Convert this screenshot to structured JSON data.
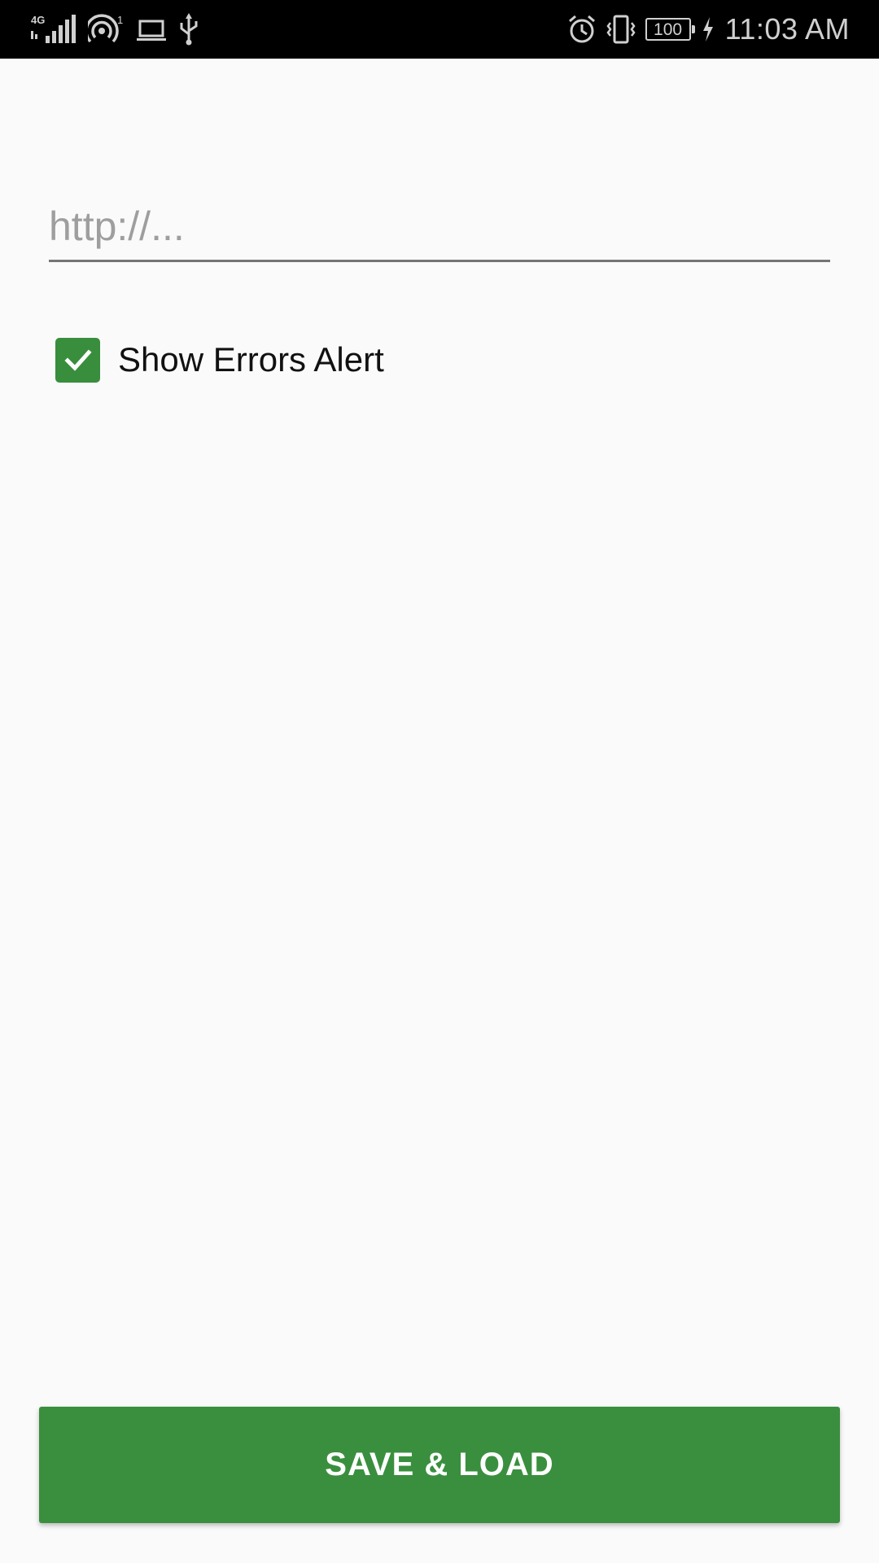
{
  "status_bar": {
    "network_label": "4G",
    "hotspot_count": "1",
    "battery_level": "100",
    "time": "11:03 AM",
    "left_icons": [
      "signal-4g-icon",
      "hotspot-icon",
      "laptop-icon",
      "usb-icon"
    ],
    "right_icons": [
      "alarm-icon",
      "vibrate-icon",
      "battery-icon",
      "charging-icon"
    ]
  },
  "url_field": {
    "value": "",
    "placeholder": "http://..."
  },
  "errors_checkbox": {
    "label": "Show Errors Alert",
    "checked": true
  },
  "save_button": {
    "label": "SAVE & LOAD"
  },
  "colors": {
    "accent": "#388e3c",
    "button": "#3a8f3e",
    "background": "#fafafa",
    "status_bar": "#000000"
  }
}
